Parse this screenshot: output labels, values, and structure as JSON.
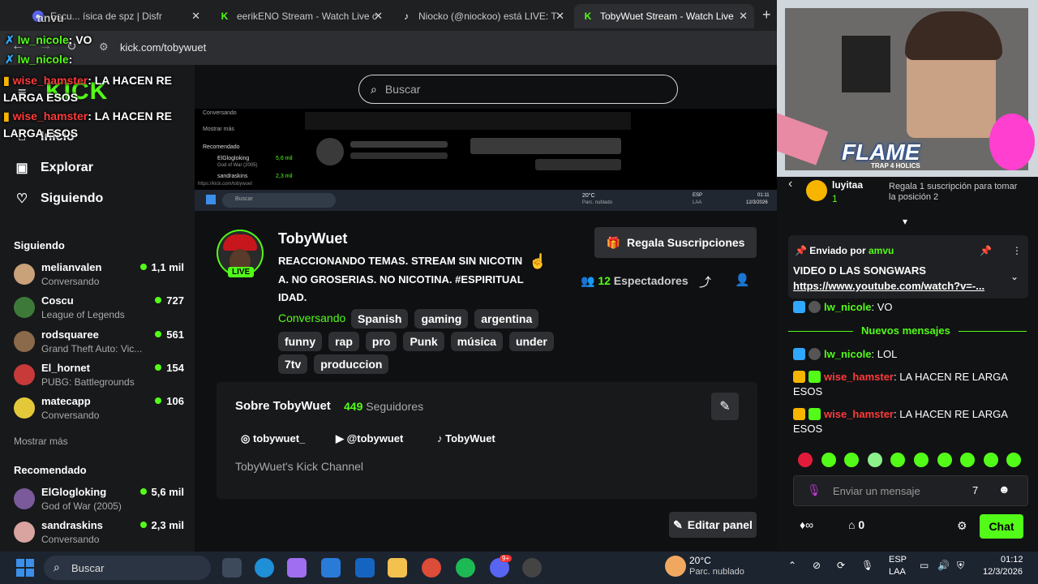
{
  "browser": {
    "tabs": [
      {
        "label": "Escu... ísica de spz | Disfr"
      },
      {
        "label": "eerikENO Stream - Watch Live c"
      },
      {
        "label": "Niocko (@niockoo) está LIVE: T"
      },
      {
        "label": "TobyWuet Stream - Watch Live"
      }
    ],
    "url": "kick.com/tobywuet"
  },
  "overlay": {
    "lines": [
      {
        "user": "lw_nicole",
        "text": ": VO"
      },
      {
        "user": "lw_nicole",
        "text": ":"
      },
      {
        "user": "wise_hamster",
        "text": ": LA HACEN RE"
      },
      {
        "user": "",
        "text": "LARGA ESOS"
      },
      {
        "user": "wise_hamster",
        "text": ": LA HACEN RE"
      },
      {
        "user": "",
        "text": "LARGA ESOS"
      }
    ],
    "top_partial": "anvu"
  },
  "sidebar": {
    "nav": [
      {
        "label": "Inicio",
        "icon": "home-icon"
      },
      {
        "label": "Explorar",
        "icon": "compass-icon"
      },
      {
        "label": "Siguiendo",
        "icon": "heart-icon"
      }
    ],
    "following_heading": "Siguiendo",
    "following": [
      {
        "name": "melianvalen",
        "category": "Conversando",
        "viewers": "1,1 mil",
        "color": "#c9a27a"
      },
      {
        "name": "Coscu",
        "category": "League of Legends",
        "viewers": "727",
        "color": "#3d7a3a"
      },
      {
        "name": "rodsquaree",
        "category": "Grand Theft Auto: Vic...",
        "viewers": "561",
        "color": "#8a6a4a"
      },
      {
        "name": "El_hornet",
        "category": "PUBG: Battlegrounds",
        "viewers": "154",
        "color": "#c83a3a"
      },
      {
        "name": "matecapp",
        "category": "Conversando",
        "viewers": "106",
        "color": "#e3c93a"
      }
    ],
    "show_more": "Mostrar más",
    "recommended_heading": "Recomendado",
    "recommended": [
      {
        "name": "ElGlogloking",
        "category": "God of War (2005)",
        "viewers": "5,6 mil",
        "color": "#7a5a9a"
      },
      {
        "name": "sandraskins",
        "category": "Conversando",
        "viewers": "2,3 mil",
        "color": "#d9a3a0"
      }
    ]
  },
  "main": {
    "search_placeholder": "Buscar",
    "preview": {
      "items": [
        "Conversando",
        "Mostrar más",
        "Recomendado",
        "ElGlogloking",
        "God of War (2005)",
        "sandraskins"
      ],
      "viewers": [
        "5,6 mil",
        "2,3 mil"
      ],
      "url": "https://kick.com/tobywuet",
      "search": "Buscar",
      "weather": "20°C",
      "weather_sub": "Parc. nublado",
      "lang": "ESP",
      "lang_sub": "LAA",
      "time": "01:11",
      "date": "12/3/2026"
    },
    "channel": {
      "name": "TobyWuet",
      "live_badge": "LIVE",
      "title": "REACCIONANDO TEMAS. STREAM SIN NICOTINA. NO GROSERIAS. NO NICOTINA. #ESPIRITUALIDAD.",
      "category": "Conversando",
      "tags": [
        "Spanish",
        "gaming",
        "argentina",
        "funny",
        "rap",
        "pro",
        "Punk",
        "música",
        "under",
        "7tv",
        "produccion"
      ],
      "gift_button": "Regala Suscripciones",
      "viewers_count": "12",
      "viewers_label": "Espectadores"
    },
    "about": {
      "title": "Sobre TobyWuet",
      "followers_count": "449",
      "followers_label": "Seguidores",
      "socials": [
        {
          "label": "tobywuet_",
          "icon": "instagram-icon"
        },
        {
          "label": "@tobywuet",
          "icon": "youtube-icon"
        },
        {
          "label": "TobyWuet",
          "icon": "tiktok-icon"
        }
      ],
      "description": "TobyWuet's Kick Channel"
    },
    "edit_panel_button": "Editar panel"
  },
  "stream": {
    "overlay_text": "FLAME",
    "overlay_sub": "TRAP 4 HOLICS"
  },
  "chat": {
    "gift_user": "luyitaa",
    "gift_count": "1",
    "gift_text": "Regala 1 suscripción para tomar la posición 2",
    "pinned_by_label": "Enviado por",
    "pinned_user": "amvu",
    "pinned_text": "VIDEO D LAS SONGWARS",
    "pinned_link": "https://www.youtube.com/watch?v=-...",
    "messages_before": [
      {
        "user": "lw_nicole",
        "text": ": VO",
        "color": "#53fc18"
      }
    ],
    "new_messages_label": "Nuevos mensajes",
    "messages_after": [
      {
        "user": "lw_nicole",
        "text": ": LOL",
        "color": "#53fc18"
      },
      {
        "user": "wise_hamster",
        "text": ": LA HACEN RE LARGA ESOS",
        "color": "#ff3b3b"
      },
      {
        "user": "wise_hamster",
        "text": ": LA HACEN RE LARGA ESOS",
        "color": "#ff3b3b"
      }
    ],
    "input_placeholder": "Enviar un mensaje",
    "points": "0",
    "chat_button": "Chat"
  },
  "taskbar": {
    "search": "Buscar",
    "weather_temp": "20°C",
    "weather_desc": "Parc. nublado",
    "lang": "ESP",
    "lang_sub": "LAA",
    "time": "01:12",
    "date": "12/3/2026",
    "notification_badge": "9+"
  },
  "colors": {
    "accent": "#53fc18",
    "background": "#111214",
    "panel": "#18191b"
  }
}
